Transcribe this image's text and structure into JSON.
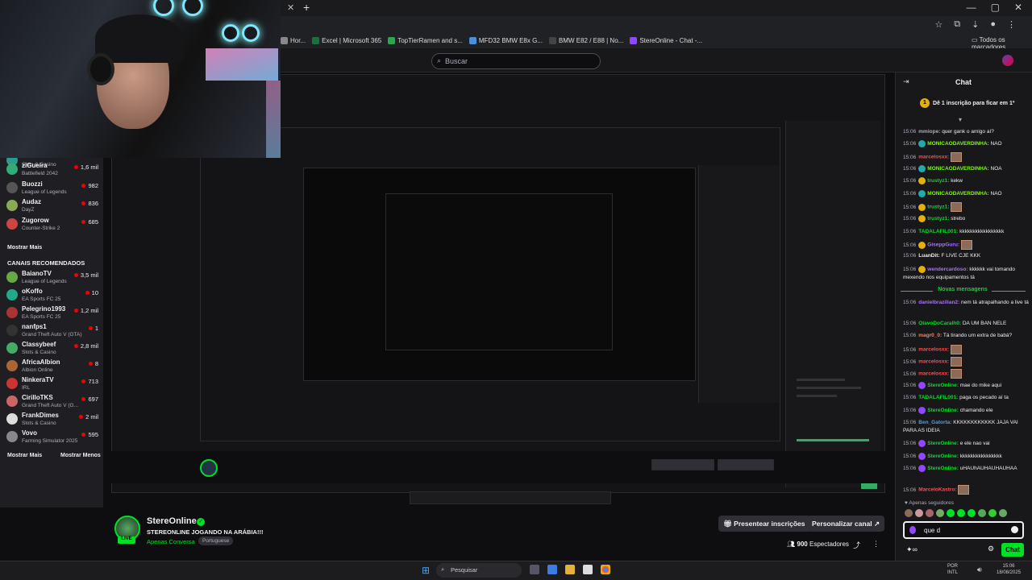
{
  "browser": {
    "bookmarks": [
      {
        "label": "Hor...",
        "color": "#888888"
      },
      {
        "label": "Excel | Microsoft 365",
        "color": "#1d6f42"
      },
      {
        "label": "TopTierRamen and s...",
        "color": "#2da44e"
      },
      {
        "label": "MFD32 BMW E8x G...",
        "color": "#4a90d9"
      },
      {
        "label": "BMW E82 / E88 | No...",
        "color": "#444444"
      },
      {
        "label": "StereOnline - Chat -...",
        "color": "#9147ff"
      }
    ],
    "all_bookmarks": "Todos os marcadores"
  },
  "twitch": {
    "search_placeholder": "Buscar",
    "sidebar": {
      "top_channels": [
        {
          "name": "",
          "game": "Slots & Casino",
          "viewers": ""
        },
        {
          "name": "ziGueira",
          "game": "Battlefield 2042",
          "viewers": "1,6 mil"
        },
        {
          "name": "Buozzi",
          "game": "League of Legends",
          "viewers": "982"
        },
        {
          "name": "Audaz",
          "game": "DayZ",
          "viewers": "836"
        },
        {
          "name": "Zugorow",
          "game": "Counter-Strike 2",
          "viewers": "685"
        }
      ],
      "show_more": "Mostrar Mais",
      "recommended_header": "CANAIS RECOMENDADOS",
      "recommended": [
        {
          "name": "BaianoTV",
          "game": "League of Legends",
          "viewers": "3,5 mil"
        },
        {
          "name": "oKoffo",
          "game": "EA Sports FC 25",
          "viewers": "10"
        },
        {
          "name": "Pelegrino1993",
          "game": "EA Sports FC 25",
          "viewers": "1,2 mil"
        },
        {
          "name": "nanfps1",
          "game": "Grand Theft Auto V (GTA)",
          "viewers": "1"
        },
        {
          "name": "Classybeef",
          "game": "Slots & Casino",
          "viewers": "2,8 mil"
        },
        {
          "name": "AfricaAlbion",
          "game": "Albion Online",
          "viewers": "8"
        },
        {
          "name": "NinkeraTV",
          "game": "IRL",
          "viewers": "713"
        },
        {
          "name": "CirilloTKS",
          "game": "Grand Theft Auto V (G...",
          "viewers": "697"
        },
        {
          "name": "FrankDimes",
          "game": "Slots & Casino",
          "viewers": "2 mil"
        },
        {
          "name": "Vovo",
          "game": "Farming Simulator 2025",
          "viewers": "595"
        }
      ],
      "show_more_bottom": "Mostrar Mais",
      "show_less": "Mostrar Menos"
    },
    "stream": {
      "live_badge": "LIVE",
      "channel": "StereOnline",
      "title": "STEREONLINE JOGANDO NA ARÁBIA!!!",
      "category": "Apenas Conversa",
      "tag": "Portuguese",
      "gift_button": "Presentear inscrições",
      "customize_button": "Personalizar canal",
      "viewers": "900",
      "viewers_label": "Espectadores"
    },
    "chat": {
      "header": "Chat",
      "sub_banner": "Dê 1 inscrição para ficar em 1º",
      "sub_rank": "1",
      "messages": [
        {
          "time": "15:06",
          "user": "mmiope:",
          "color": "#adadb8",
          "text": "quer gank o amigo aí?",
          "badge": ""
        },
        {
          "time": "15:06",
          "user": "MONICAODAVERDINHA:",
          "color": "#7cfc00",
          "text": "NAO",
          "badge": "#2aa"
        },
        {
          "time": "15:06",
          "user": "marcelosxx:",
          "color": "#ff4f4f",
          "text": "",
          "badge": "",
          "emote": true
        },
        {
          "time": "15:06",
          "user": "MONICAODAVERDINHA:",
          "color": "#7cfc00",
          "text": "NOA",
          "badge": "#2aa"
        },
        {
          "time": "15:06",
          "user": "trustyz1:",
          "color": "#00e025",
          "text": "kekw",
          "badge": "#e5b00b"
        },
        {
          "time": "15:06",
          "user": "MONICAODAVERDINHA:",
          "color": "#7cfc00",
          "text": "NAO",
          "badge": "#2aa"
        },
        {
          "time": "15:06",
          "user": "trustyz1:",
          "color": "#00e025",
          "text": "",
          "badge": "#e5b00b",
          "emote": true
        },
        {
          "time": "15:06",
          "user": "trustyz1:",
          "color": "#00e025",
          "text": "strebo",
          "badge": "#e5b00b"
        },
        {
          "time": "15:06",
          "user": "TADALAFIL001:",
          "color": "#00e025",
          "text": "kkkkkkkkkkkkkkkkk",
          "badge": ""
        },
        {
          "time": "15:06",
          "user": "GiseppGuru:",
          "color": "#a970ff",
          "text": "",
          "badge": "#e5b00b",
          "emote": true
        },
        {
          "time": "15:06",
          "user": "LuanDit:",
          "color": "#efeff1",
          "text": "F LIVE CJE KKK",
          "badge": ""
        },
        {
          "time": "15:06",
          "user": "wendercardoso:",
          "color": "#a970ff",
          "text": "kkkkkk vai tomando mexendo nos equipamentos tá",
          "badge": "#e5b00b"
        }
      ],
      "new_messages_label": "Novas mensagens",
      "new_messages": [
        {
          "time": "15:06",
          "user": "danielbrazilian2:",
          "color": "#a970ff",
          "text": "nem tá atrapalhando a live tá",
          "badge": ""
        },
        {
          "time": "15:06",
          "user": "OlavoDoCaralh0:",
          "color": "#00e025",
          "text": "DA UM BAN NELE",
          "badge": ""
        },
        {
          "time": "15:06",
          "user": "magr0_0:",
          "color": "#ff7f50",
          "text": "Tá tirando um extra de babá?",
          "badge": ""
        },
        {
          "time": "15:06",
          "user": "marcelosxx:",
          "color": "#ff4f4f",
          "text": "",
          "badge": "",
          "emote": true
        },
        {
          "time": "15:06",
          "user": "marcelosxx:",
          "color": "#ff4f4f",
          "text": "",
          "badge": "",
          "emote": true
        },
        {
          "time": "15:06",
          "user": "marcelosxx:",
          "color": "#ff4f4f",
          "text": "",
          "badge": "",
          "emote": true
        },
        {
          "time": "15:06",
          "user": "StereOnline:",
          "color": "#00e025",
          "text": "mae do mike aqui",
          "badge": "#9147ff"
        },
        {
          "time": "15:06",
          "user": "TADALAFIL001:",
          "color": "#00e025",
          "text": "paga os pecado aí ta",
          "badge": ""
        },
        {
          "time": "15:06",
          "user": "StereOnline:",
          "color": "#00e025",
          "text": "chamando ele",
          "badge": "#9147ff"
        },
        {
          "time": "15:06",
          "user": "Ben_Gatorta:",
          "color": "#5b9bd5",
          "text": "KKKKKKKKKKKK JAJA VAI PARA AS IDEIA",
          "badge": ""
        },
        {
          "time": "15:06",
          "user": "StereOnline:",
          "color": "#00e025",
          "text": "e ele nao vai",
          "badge": "#9147ff"
        },
        {
          "time": "15:06",
          "user": "StereOnline:",
          "color": "#00e025",
          "text": "kkkkkkkkkkkkkkkk",
          "badge": "#9147ff"
        },
        {
          "time": "15:06",
          "user": "StereOnline:",
          "color": "#00e025",
          "text": "uHAUhAUHAUHAUHAA",
          "badge": "#9147ff"
        },
        {
          "time": "15:06",
          "user": "MarceloKastro:",
          "color": "#ff4f4f",
          "text": "",
          "badge": "",
          "emote": true
        }
      ],
      "followers_only": "Apenas seguidores",
      "input_value": "que d",
      "chat_button": "Chat"
    }
  },
  "taskbar": {
    "search": "Pesquisar",
    "lang_top": "POR",
    "lang_bottom": "INTL",
    "time": "15:06",
    "date": "18/08/2025"
  }
}
